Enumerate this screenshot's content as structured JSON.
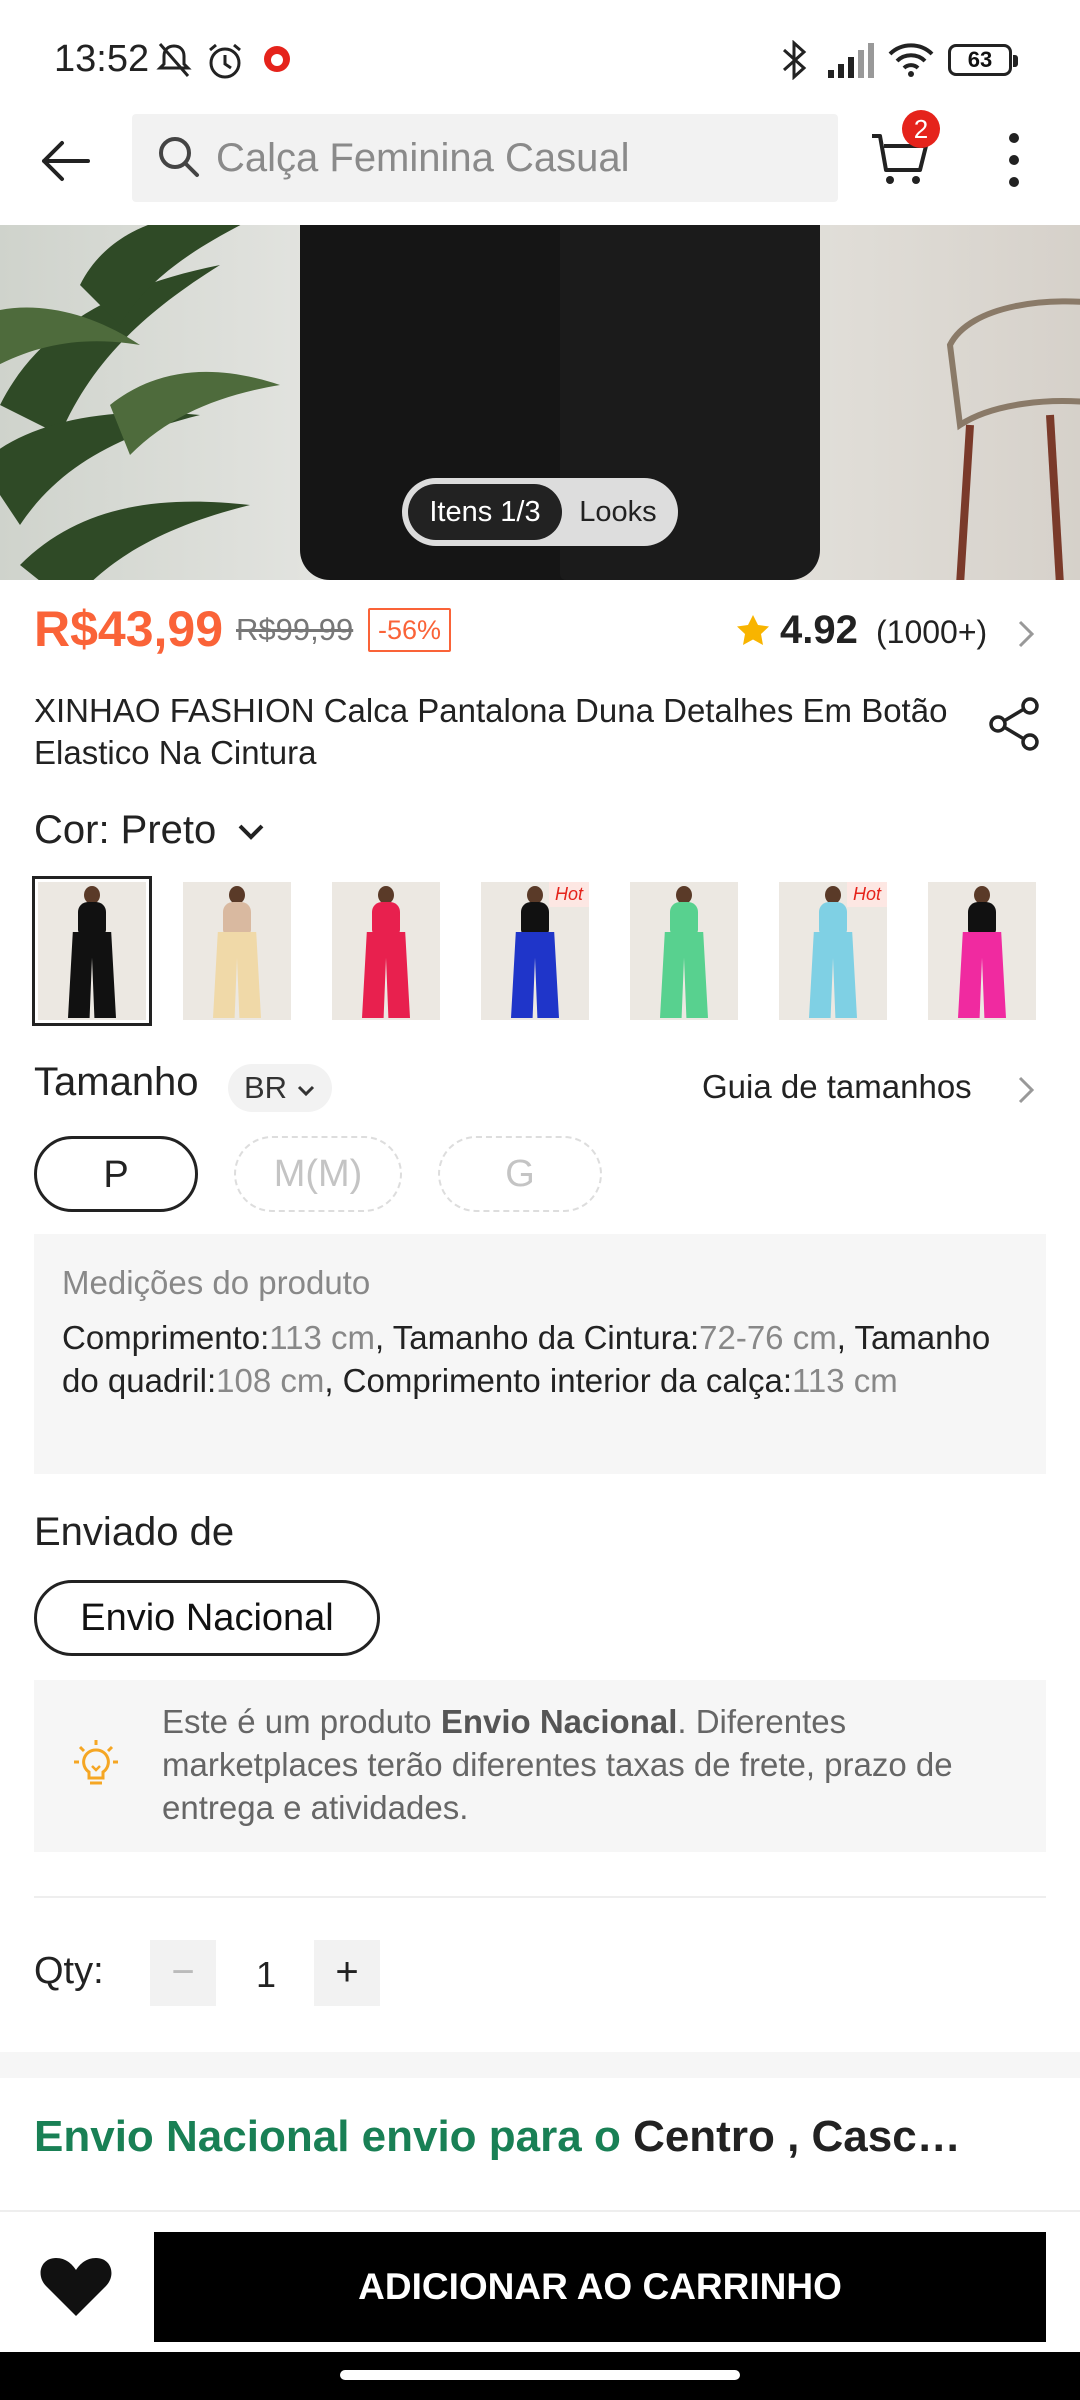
{
  "status_bar": {
    "time": "13:52",
    "battery": "63"
  },
  "search": {
    "placeholder": "Calça Feminina Casual"
  },
  "cart": {
    "badge_count": "2"
  },
  "gallery": {
    "items_tab": "Itens 1/3",
    "looks_tab": "Looks"
  },
  "product": {
    "price": "R$43,99",
    "original_price": "R$99,99",
    "discount": "-56%",
    "rating": "4.92",
    "rating_count": "(1000+)",
    "title": "XINHAO FASHION Calca Pantalona Duna Detalhes Em Botão Elastico Na Cintura"
  },
  "color": {
    "label": "Cor: Preto",
    "swatches": [
      {
        "color": "#111111",
        "top": "#111111",
        "hot": false,
        "selected": true
      },
      {
        "color": "#f0d9a8",
        "top": "#d9b9a0",
        "hot": false,
        "selected": false
      },
      {
        "color": "#e8204e",
        "top": "#e8204e",
        "hot": false,
        "selected": false
      },
      {
        "color": "#1f35c9",
        "top": "#111111",
        "hot": true,
        "selected": false
      },
      {
        "color": "#58d18f",
        "top": "#58d18f",
        "hot": false,
        "selected": false
      },
      {
        "color": "#7fd0e4",
        "top": "#7fd0e4",
        "hot": true,
        "selected": false
      },
      {
        "color": "#f02aa0",
        "top": "#111111",
        "hot": false,
        "selected": false
      }
    ],
    "hot_label": "Hot"
  },
  "size": {
    "label": "Tamanho",
    "region": "BR",
    "guide": "Guia de tamanhos",
    "options": [
      "P",
      "M(M)",
      "G"
    ],
    "selected": "P"
  },
  "measurements": {
    "heading": "Medições do produto",
    "items": [
      {
        "label": "Comprimento:",
        "value": "113 cm"
      },
      {
        "label": "Tamanho da Cintura:",
        "value": "72-76 cm"
      },
      {
        "label": "Tamanho do quadril:",
        "value": "108 cm"
      },
      {
        "label": "Comprimento interior da calça:",
        "value": "113 cm"
      }
    ]
  },
  "shipping": {
    "label": "Enviado de",
    "option": "Envio Nacional",
    "notice_prefix": "Este é um produto ",
    "notice_bold": "Envio Nacional",
    "notice_suffix": ". Diferentes marketplaces terão diferentes taxas de frete, prazo de entrega e atividades.",
    "destination_green": "Envio Nacional envio para o ",
    "destination_dark": "Centro , Casc…"
  },
  "quantity": {
    "label": "Qty:",
    "value": "1",
    "minus": "−",
    "plus": "+"
  },
  "actions": {
    "add_to_cart": "ADICIONAR AO CARRINHO"
  },
  "colors": {
    "accent_price": "#fa6338",
    "shipping_green": "#198055",
    "badge_red": "#e5231b"
  }
}
